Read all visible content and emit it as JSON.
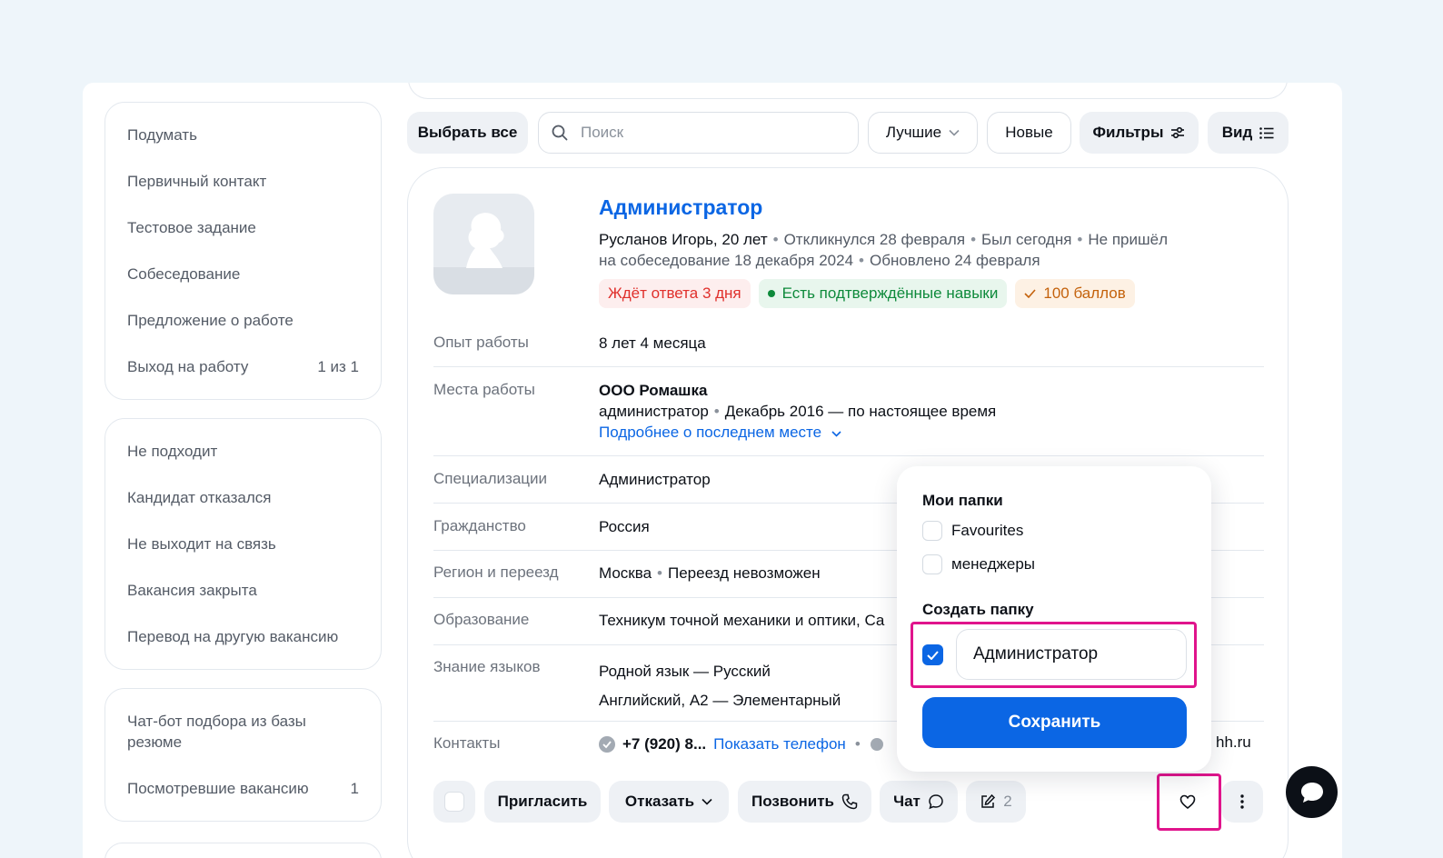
{
  "sidebar": {
    "group1": [
      {
        "label": "Подумать",
        "count": ""
      },
      {
        "label": "Первичный контакт",
        "count": ""
      },
      {
        "label": "Тестовое задание",
        "count": ""
      },
      {
        "label": "Собеседование",
        "count": ""
      },
      {
        "label": "Предложение о работе",
        "count": ""
      },
      {
        "label": "Выход на работу",
        "count": "1 из 1"
      }
    ],
    "group2": [
      {
        "label": "Не подходит"
      },
      {
        "label": "Кандидат отказался"
      },
      {
        "label": "Не выходит на связь"
      },
      {
        "label": "Вакансия закрыта"
      },
      {
        "label": "Перевод на другую вакансию"
      }
    ],
    "group3": [
      {
        "label": "Чат-бот подбора из базы резюме",
        "count": ""
      },
      {
        "label": "Посмотревшие вакансию",
        "count": "1"
      }
    ]
  },
  "toolbar": {
    "select_all": "Выбрать все",
    "search_placeholder": "Поиск",
    "sort": "Лучшие",
    "new": "Новые",
    "filters": "Фильтры",
    "view": "Вид"
  },
  "candidate": {
    "position": "Администратор",
    "name_age": "Русланов Игорь, 20 лет",
    "responded": "Откликнулся 28 февраля",
    "last_seen": "Был сегодня",
    "no_show_a": "Не пришёл",
    "no_show_b": "на собеседование 18 декабря 2024",
    "updated": "Обновлено 24 февраля",
    "tags": {
      "waiting": "Ждёт ответа 3 дня",
      "skills": "Есть подтверждённые навыки",
      "score": "100 баллов"
    }
  },
  "details": {
    "experience_label": "Опыт работы",
    "experience_value": "8 лет 4 месяца",
    "workplaces_label": "Места работы",
    "company": "ООО Ромашка",
    "role": "администратор",
    "period": "Декабрь 2016 — по настоящее время",
    "more_link": "Подробнее о последнем месте",
    "spec_label": "Специализации",
    "spec_value": "Администратор",
    "citizenship_label": "Гражданство",
    "citizenship_value": "Россия",
    "region_label": "Регион и переезд",
    "region_city": "Москва",
    "relocation": "Переезд невозможен",
    "education_label": "Образование",
    "education_value": "Техникум точной механики и оптики, Са",
    "languages_label": "Знание языков",
    "lang_native": "Родной язык — Русский",
    "lang_english": "Английский, A2 — Элементарный",
    "contacts_label": "Контакты",
    "phone": "+7 (920) 8...",
    "show_phone": "Показать телефон",
    "email_tail": "hh.ru"
  },
  "actions": {
    "invite": "Пригласить",
    "reject": "Отказать",
    "call": "Позвонить",
    "chat": "Чат",
    "notes_count": "2"
  },
  "folders_popup": {
    "my_folders_title": "Мои папки",
    "folders": [
      "Favourites",
      "менеджеры"
    ],
    "create_title": "Создать папку",
    "new_folder_value": "Администратор",
    "save": "Сохранить"
  },
  "colors": {
    "accent": "#0b66e4",
    "highlight": "#e0148c"
  }
}
